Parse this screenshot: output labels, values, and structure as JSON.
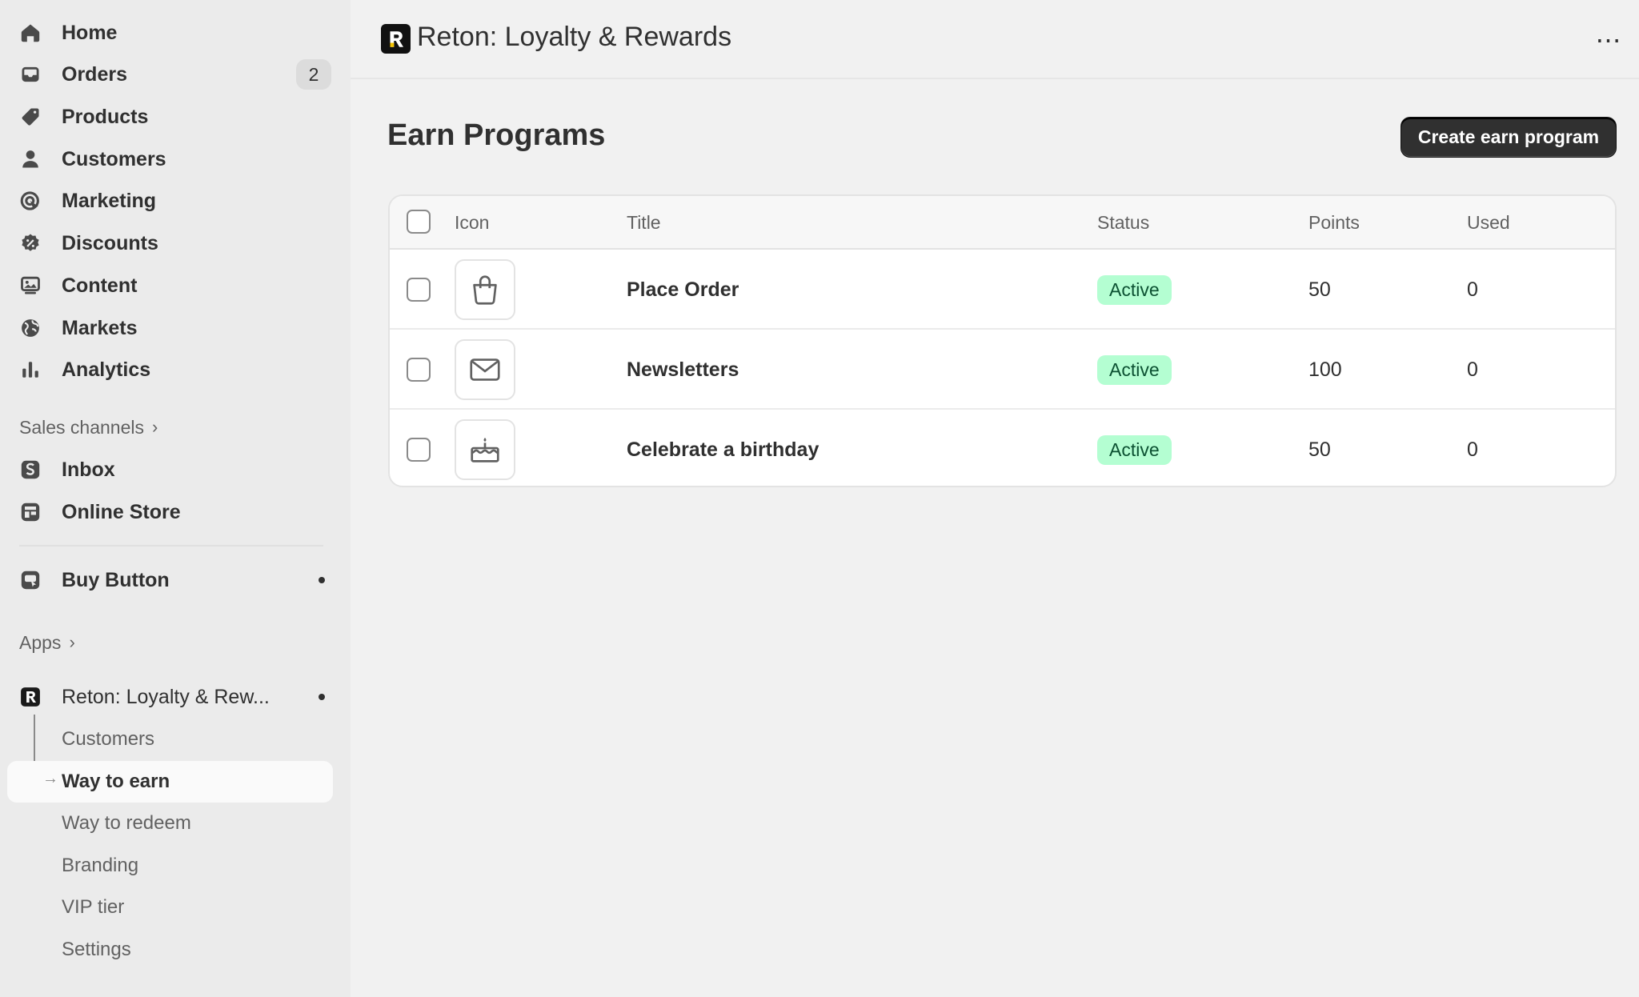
{
  "sidebar": {
    "nav": [
      {
        "label": "Home",
        "icon": "home-icon"
      },
      {
        "label": "Orders",
        "icon": "inbox-tray-icon",
        "badge": "2"
      },
      {
        "label": "Products",
        "icon": "tag-icon"
      },
      {
        "label": "Customers",
        "icon": "person-icon"
      },
      {
        "label": "Marketing",
        "icon": "target-icon"
      },
      {
        "label": "Discounts",
        "icon": "discount-badge-icon"
      },
      {
        "label": "Content",
        "icon": "content-icon"
      },
      {
        "label": "Markets",
        "icon": "globe-icon"
      },
      {
        "label": "Analytics",
        "icon": "bar-chart-icon"
      }
    ],
    "sales_channels_label": "Sales channels",
    "channels": [
      {
        "label": "Inbox",
        "icon": "inbox-app-icon"
      },
      {
        "label": "Online Store",
        "icon": "storefront-icon"
      }
    ],
    "buy_button_label": "Buy Button",
    "apps_label": "Apps",
    "app_name": "Reton: Loyalty & Rew...",
    "app_sub_items": [
      "Customers",
      "Way to earn",
      "Way to redeem",
      "Branding",
      "VIP tier",
      "Settings"
    ],
    "active_sub_item": "Way to earn"
  },
  "topbar": {
    "app_title": "Reton: Loyalty & Rewards",
    "more_label": "⋯"
  },
  "main": {
    "page_title": "Earn Programs",
    "create_button": "Create earn program",
    "table": {
      "headers": {
        "icon": "Icon",
        "title": "Title",
        "status": "Status",
        "points": "Points",
        "used": "Used"
      },
      "rows": [
        {
          "icon": "shopping-bag-icon",
          "title": "Place Order",
          "status": "Active",
          "points": "50",
          "used": "0"
        },
        {
          "icon": "envelope-icon",
          "title": "Newsletters",
          "status": "Active",
          "points": "100",
          "used": "0"
        },
        {
          "icon": "birthday-cake-icon",
          "title": "Celebrate a birthday",
          "status": "Active",
          "points": "50",
          "used": "0"
        }
      ]
    }
  },
  "colors": {
    "status_bg": "#b4fed2",
    "status_text": "#0c5132",
    "primary_button": "#303030"
  }
}
